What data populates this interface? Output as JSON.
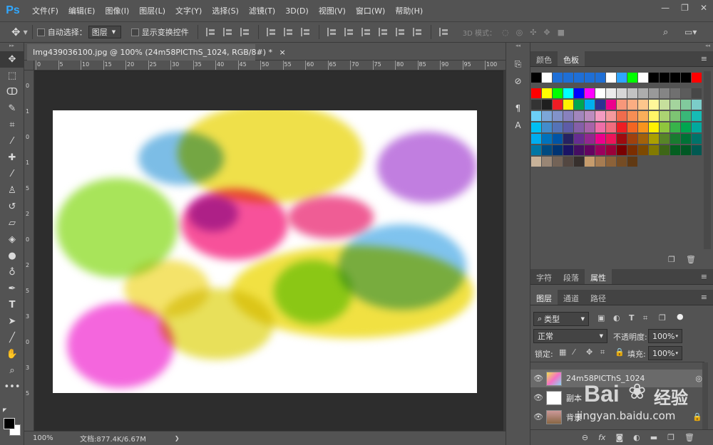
{
  "menubar": {
    "logo": "Ps",
    "items": [
      "文件(F)",
      "编辑(E)",
      "图像(I)",
      "图层(L)",
      "文字(Y)",
      "选择(S)",
      "滤镜(T)",
      "3D(D)",
      "视图(V)",
      "窗口(W)",
      "帮助(H)"
    ],
    "minimize": "—",
    "restore": "❐",
    "close": "✕"
  },
  "options": {
    "auto_select_label": "自动选择：",
    "auto_select_value": "图层",
    "show_transform_label": "显示变换控件",
    "mode3d_label": "3D 模式："
  },
  "document": {
    "tab_title": "Img439036100.jpg @ 100% (24m58PICThS_1024, RGB/8#) *",
    "close": "×",
    "zoom": "100%",
    "doc_info": "文档:877.4K/6.67M"
  },
  "ruler": {
    "top": [
      "0",
      "5",
      "10",
      "15",
      "20",
      "25",
      "30",
      "35",
      "40",
      "45",
      "50",
      "55",
      "60",
      "65",
      "70",
      "75",
      "80",
      "85",
      "90",
      "95",
      "100"
    ],
    "left": [
      "0",
      "1",
      "0",
      "1",
      "5",
      "2",
      "0",
      "2",
      "5",
      "3",
      "0",
      "3",
      "5"
    ]
  },
  "panels": {
    "top_tabs": [
      "颜色",
      "色板"
    ],
    "mid_tabs": [
      "字符",
      "段落",
      "属性"
    ],
    "layer_tabs": [
      "图层",
      "通道",
      "路径"
    ],
    "filter_kind": "类型",
    "blend_mode": "正常",
    "opacity_label": "不透明度:",
    "opacity_value": "100%",
    "lock_label": "锁定:",
    "fill_label": "填充:",
    "fill_value": "100%",
    "layers": [
      {
        "name": "24m58PICThS_1024"
      },
      {
        "name": "副本"
      },
      {
        "name": "背景"
      }
    ],
    "bottom_icons": [
      "link",
      "fx",
      "mask",
      "adjust",
      "folder",
      "new",
      "delete"
    ]
  },
  "watermark": {
    "brand": "Bai",
    "brand2": "经验",
    "url": "jingyan.baidu.com"
  },
  "swatch_colors": {
    "row1": [
      "#000000",
      "#ffffff",
      "#1f6fd6",
      "#1f6fd6",
      "#1f6fd6",
      "#1f6fd6",
      "#1f6fd6",
      "#ffffff",
      "#2fa5ff",
      "#00ff00",
      "#ffffff",
      "#000000",
      "#000000",
      "#000000",
      "#000000",
      "#ff0000"
    ],
    "row2": [
      "#ff0000",
      "#ffff00",
      "#00ff00",
      "#00ffff",
      "#0000ff",
      "#ff00ff",
      "#ffffff",
      "#ebebeb",
      "#d6d6d6",
      "#c2c2c2",
      "#adadad",
      "#999999",
      "#858585",
      "#707070",
      "#5c5c5c",
      "#474747"
    ],
    "row3": [
      "#333333",
      "#1f1f1f",
      "#ee1c24",
      "#fff200",
      "#00a651",
      "#00aeef",
      "#2e3192",
      "#ec008c",
      "#f7977a",
      "#fbad82",
      "#fdc68c",
      "#fff799",
      "#c6df9c",
      "#a4d49d",
      "#81ca9d",
      "#7bcdc9"
    ],
    "row4": [
      "#6ccff7",
      "#7ca6d8",
      "#8293ca",
      "#8881be",
      "#a286bd",
      "#bc8cbf",
      "#f49bc1",
      "#f5999d",
      "#f16c4d",
      "#f68e54",
      "#fbaf5a",
      "#fff467",
      "#acd372",
      "#7dc473",
      "#39b778",
      "#16bcb4"
    ],
    "row5": [
      "#00bff3",
      "#438ccb",
      "#5573b7",
      "#5e5ca7",
      "#855fa8",
      "#a763a9",
      "#ef6ea8",
      "#f16d7e",
      "#ee1d23",
      "#f26522",
      "#f7941d",
      "#fff100",
      "#8fc63d",
      "#37b44a",
      "#00a650",
      "#00a99e"
    ],
    "row6": [
      "#00adef",
      "#0072bc",
      "#0054a5",
      "#262262",
      "#662d91",
      "#92278f",
      "#ec008c",
      "#ed145a",
      "#9e0b0f",
      "#a0410d",
      "#a3620a",
      "#aba000",
      "#588528",
      "#197b30",
      "#007236",
      "#00736a"
    ],
    "row7": [
      "#0076a4",
      "#004a80",
      "#003472",
      "#1b1464",
      "#440e62",
      "#630460",
      "#9b005d",
      "#9b0039",
      "#790000",
      "#7b2e00",
      "#7d4900",
      "#827a00",
      "#3e6617",
      "#045f20",
      "#005824",
      "#005951"
    ],
    "row8": [
      "#c7b299",
      "#998675",
      "#736357",
      "#534741",
      "#37302d",
      "#c69c6d",
      "#a67c52",
      "#8c6239",
      "#754c24",
      "#603913"
    ]
  }
}
